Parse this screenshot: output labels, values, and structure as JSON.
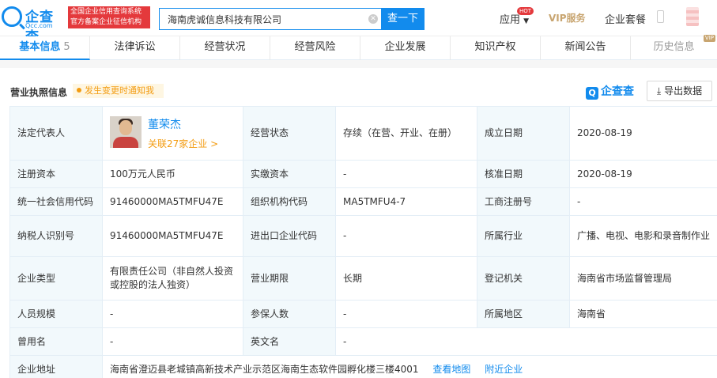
{
  "header": {
    "logo_text": "企查查",
    "logo_domain": "Qcc.com",
    "slogan_line1": "全国企业信用查询系统",
    "slogan_line2": "官方备案企业征信机构",
    "search_value": "海南虎诚信息科技有限公司",
    "search_button": "查一下",
    "nav_app": "应用",
    "hot_badge": "HOT",
    "nav_vip": "VIP服务",
    "nav_package": "企业套餐"
  },
  "tabs": [
    {
      "label": "基本信息",
      "count": "5"
    },
    {
      "label": "法律诉讼"
    },
    {
      "label": "经营状况"
    },
    {
      "label": "经营风险"
    },
    {
      "label": "企业发展"
    },
    {
      "label": "知识产权"
    },
    {
      "label": "新闻公告"
    },
    {
      "label": "历史信息",
      "badge": "VIP"
    }
  ],
  "section": {
    "title": "营业执照信息",
    "notify": "发生变更时通知我",
    "brand": "企查查",
    "export": "导出数据"
  },
  "table": {
    "legal_rep_label": "法定代表人",
    "legal_rep_name": "董荣杰",
    "legal_rep_related": "关联27家企业 >",
    "status_label": "经营状态",
    "status_value": "存续（在营、开业、在册）",
    "found_date_label": "成立日期",
    "found_date_value": "2020-08-19",
    "reg_capital_label": "注册资本",
    "reg_capital_value": "100万元人民币",
    "paid_capital_label": "实缴资本",
    "paid_capital_value": "-",
    "approve_date_label": "核准日期",
    "approve_date_value": "2020-08-19",
    "credit_code_label": "统一社会信用代码",
    "credit_code_value": "91460000MA5TMFU47E",
    "org_code_label": "组织机构代码",
    "org_code_value": "MA5TMFU4-7",
    "biz_reg_no_label": "工商注册号",
    "biz_reg_no_value": "-",
    "taxpayer_label": "纳税人识别号",
    "taxpayer_value": "91460000MA5TMFU47E",
    "import_export_label": "进出口企业代码",
    "import_export_value": "-",
    "industry_label": "所属行业",
    "industry_value": "广播、电视、电影和录音制作业",
    "company_type_label": "企业类型",
    "company_type_value": "有限责任公司（非自然人投资或控股的法人独资）",
    "term_label": "营业期限",
    "term_value": "长期",
    "authority_label": "登记机关",
    "authority_value": "海南省市场监督管理局",
    "staff_label": "人员规模",
    "staff_value": "-",
    "insured_label": "参保人数",
    "insured_value": "-",
    "region_label": "所属地区",
    "region_value": "海南省",
    "former_name_label": "曾用名",
    "former_name_value": "-",
    "english_name_label": "英文名",
    "english_name_value": "-",
    "address_label": "企业地址",
    "address_value": "海南省澄迈县老城镇高新技术产业示范区海南生态软件园孵化楼三楼4001",
    "view_map": "查看地图",
    "nearby": "附近企业"
  }
}
